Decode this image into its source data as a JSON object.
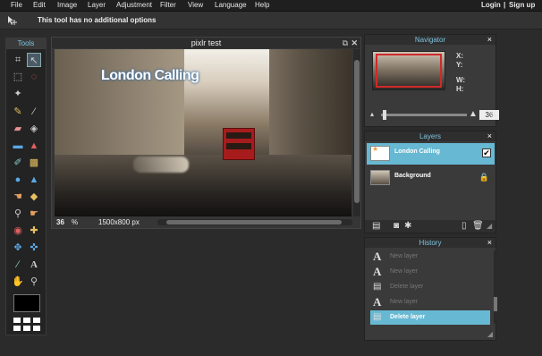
{
  "menu": {
    "items": [
      "File",
      "Edit",
      "Image",
      "Layer",
      "Adjustment",
      "Filter",
      "View",
      "Language",
      "Help"
    ],
    "login": "Login",
    "separator": "|",
    "signup": "Sign up"
  },
  "options_bar": {
    "message": "This tool has no additional options"
  },
  "tools": {
    "title": "Tools",
    "primary_color": "#000000",
    "icons": [
      "crop-icon",
      "move-icon",
      "marquee-icon",
      "lasso-icon",
      "magic-wand-icon",
      "pencil-icon",
      "brush-icon",
      "eraser-icon",
      "paint-bucket-icon",
      "gradient-icon",
      "stamp-icon",
      "color-replace-icon",
      "drawing-icon",
      "blur-icon",
      "sharpen-icon",
      "smudge-icon",
      "sponge-icon",
      "dodge-icon",
      "burn-icon",
      "red-eye-icon",
      "spot-heal-icon",
      "bloat-icon",
      "pinch-icon",
      "color-picker-icon",
      "type-icon",
      "hand-icon",
      "zoom-icon"
    ]
  },
  "image_window": {
    "title": "pixlr test",
    "photo_text": "London Calling",
    "zoom_value": "36",
    "zoom_unit": "%",
    "dimensions": "1500x800 px",
    "window_controls": [
      "maximize-icon",
      "close-icon"
    ]
  },
  "navigator": {
    "title": "Navigator",
    "close": "×",
    "labels": {
      "x": "X:",
      "y": "Y:",
      "w": "W:",
      "h": "H:"
    },
    "zoom_value": "36",
    "zoom_unit": "%"
  },
  "layers": {
    "title": "Layers",
    "close": "×",
    "items": [
      {
        "name": "London Calling",
        "selected": true,
        "visible": true
      },
      {
        "name": "Background",
        "selected": false,
        "locked": true
      }
    ]
  },
  "history": {
    "title": "History",
    "close": "×",
    "items": [
      {
        "label": "New layer",
        "icon": "A"
      },
      {
        "label": "New layer",
        "icon": "A"
      },
      {
        "label": "Delete layer",
        "icon": "doc"
      },
      {
        "label": "New layer",
        "icon": "A"
      },
      {
        "label": "Delete layer",
        "icon": "doc",
        "selected": true
      }
    ]
  },
  "colors": {
    "accent": "#67b9d3",
    "panel_title": "#7ec4e0",
    "bus_red": "#a61c1c"
  }
}
